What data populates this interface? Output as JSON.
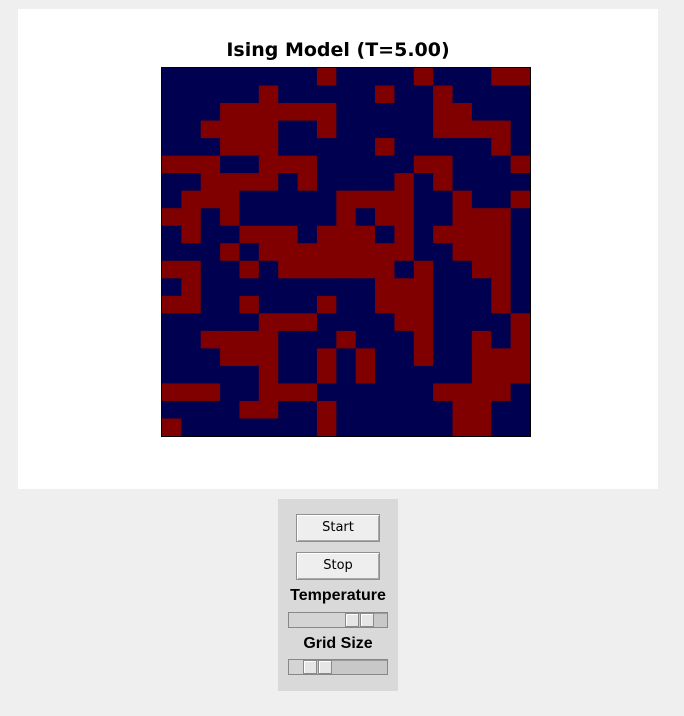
{
  "plot": {
    "title": "Ising Model (T=5.00)",
    "colors": {
      "spin_up": "#800000",
      "spin_down": "#000050"
    },
    "grid": [
      "DDDDDDDDUDDDDUDDDUU",
      "DDDDDUDDDDDUDDUDDDD",
      "DDDUUUUUUDDDDDUUDDD",
      "DDUUUUDDUDDDDDUUUUD",
      "DDDUUUDDDDDUDDDDDUD",
      "UUUDDUUUDDDDDUUDDDU",
      "DDUUUUDUDDDDUDUDDDD",
      "DUUUDDDDDUUUUDDUDDU",
      "UUDUDDDDDUDUUDDUUUD",
      "DUDDUUUDUUUDUDUUUUD",
      "DDDUDUUUUUUUUDDUUUD",
      "UUDDUDUUUUUUDUDDUUD",
      "DUDDDDDDDDDUUUDDDUD",
      "UUDDUDDDUDDUUUDDDUD",
      "DDDDDUUUDDDDUUDDDDU",
      "DDUUUUDDDUDDDUDDUDU",
      "DDDUUUDDUDUDDUDDUUU",
      "DDDDDUDDUDUDDDDDUUU",
      "UUUDDUUUDDDDDDUUUUD",
      "DDDDUUDDUDDDDDDUUDD",
      "UDDDDDDDUDDDDDDUUDD"
    ]
  },
  "controls": {
    "start_label": "Start",
    "stop_label": "Stop",
    "temperature_label": "Temperature",
    "temperature_value": 0.8,
    "grid_size_label": "Grid Size",
    "grid_size_value": 0.2
  }
}
